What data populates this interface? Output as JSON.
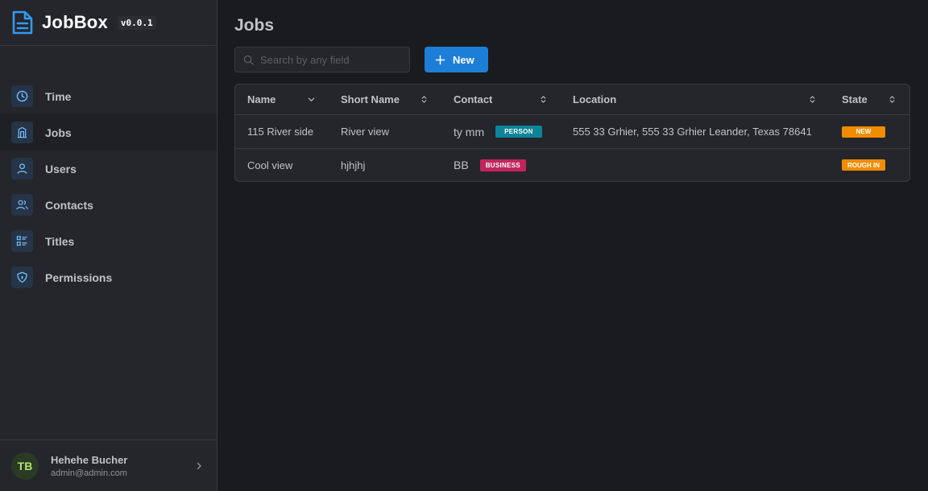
{
  "app": {
    "name": "JobBox",
    "version": "v0.0.1"
  },
  "sidebar": {
    "items": [
      {
        "label": "Time",
        "icon": "clock-icon"
      },
      {
        "label": "Jobs",
        "icon": "building-icon",
        "active": true
      },
      {
        "label": "Users",
        "icon": "user-icon"
      },
      {
        "label": "Contacts",
        "icon": "users-icon"
      },
      {
        "label": "Titles",
        "icon": "list-details-icon"
      },
      {
        "label": "Permissions",
        "icon": "shield-icon"
      }
    ]
  },
  "user": {
    "initials": "TB",
    "name": "Hehehe Bucher",
    "email": "admin@admin.com"
  },
  "page": {
    "title": "Jobs"
  },
  "toolbar": {
    "search_placeholder": "Search by any field",
    "search_value": "",
    "new_label": "New"
  },
  "table": {
    "columns": [
      "Name",
      "Short Name",
      "Contact",
      "Location",
      "State"
    ],
    "rows": [
      {
        "name": "115 River side",
        "short_name": "River view",
        "contact": "ty mm",
        "contact_type": "PERSON",
        "location": "555 33 Grhier, 555 33 Grhier Leander, Texas 78641",
        "state": "NEW"
      },
      {
        "name": "Cool view",
        "short_name": "hjhjhj",
        "contact": "BB",
        "contact_type": "BUSINESS",
        "location": "",
        "state": "ROUGH IN"
      }
    ]
  },
  "colors": {
    "accent": "#1c7ed6",
    "person_badge": "#0c8599",
    "business_badge": "#c2255c",
    "state_badge": "#f08c00",
    "brand_logo": "#339af0"
  }
}
